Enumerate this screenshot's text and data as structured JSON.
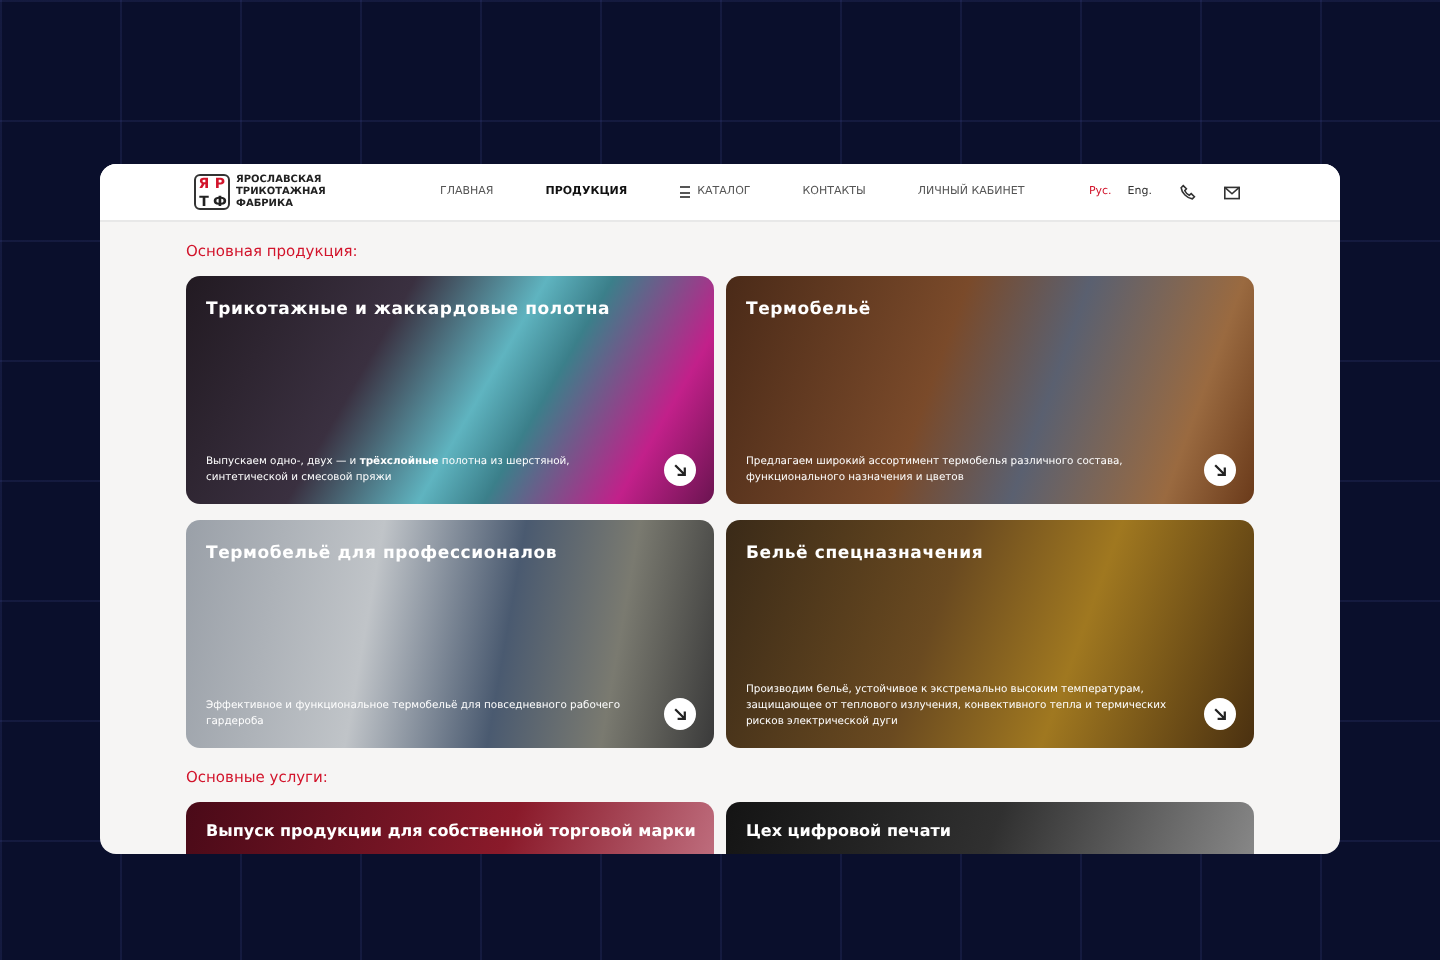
{
  "logo": {
    "letters": [
      "Я",
      "Р",
      "Т",
      "Ф"
    ],
    "name": "ЯРОСЛАВСКАЯ ТРИКОТАЖНАЯ ФАБРИКА"
  },
  "nav": [
    {
      "label": "ГЛАВНАЯ",
      "selected": false
    },
    {
      "label": "ПРОДУКЦИЯ",
      "selected": true
    },
    {
      "label": "КАТАЛОГ",
      "selected": false,
      "kind": "menu"
    },
    {
      "label": "КОНТАКТЫ",
      "selected": false
    },
    {
      "label": "ЛИЧНЫЙ КАБИНЕТ",
      "selected": false
    }
  ],
  "languages": [
    {
      "label": "Рус.",
      "selected": true
    },
    {
      "label": "Eng.",
      "selected": false
    }
  ],
  "sections": [
    {
      "title": "Основная продукция:",
      "cards": [
        {
          "title": "Трикотажные и жаккардовые полотна",
          "text": "Выпускаем одно-, двух — и **трёхслойные** полотна из шерстяной, синтетической и смесовой пряжи",
          "kind": "fabric"
        },
        {
          "title": "Термобельё",
          "text": "Предлагаем широкий ассортимент термобелья различного состава, функционального назначения и цветов",
          "kind": "wood"
        },
        {
          "title": "Термобельё для профессионалов",
          "text": "Эффективное и функциональное термобельё для повседневного рабочего гардероба",
          "kind": "factory"
        },
        {
          "title": "Бельё спецназначения",
          "text": "Производим бельё, устойчивое к экстремально высоким температурам, защищающее от теплового излучения, конвективного тепла и термических рисков электрической дуги",
          "kind": "fire"
        }
      ]
    },
    {
      "title": "Основные услуги:",
      "cards": [
        {
          "title": "Выпуск продукции для собственной торговой марки",
          "kind": "red"
        },
        {
          "title": "Цех цифровой печати",
          "kind": "print"
        }
      ]
    }
  ]
}
